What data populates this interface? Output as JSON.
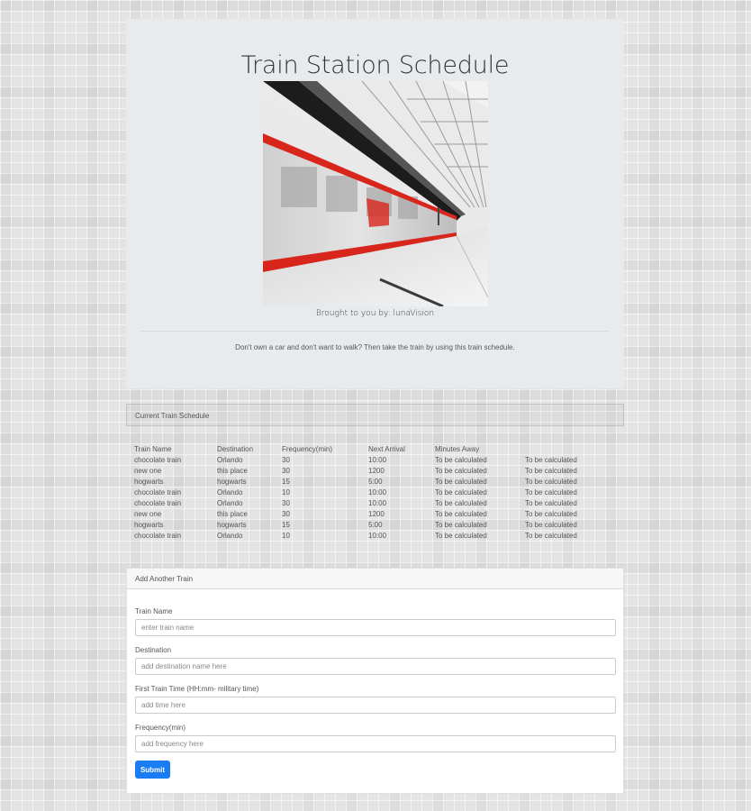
{
  "jumbotron": {
    "title": "Train Station Schedule",
    "byline": "Brought to you by: lunaVision",
    "tagline": "Don't own a car and don't want to walk? Then take the train by using this train schedule."
  },
  "schedule": {
    "header": "Current Train Schedule",
    "columns": [
      "Train Name",
      "Destination",
      "Frequency(min)",
      "Next Arrival",
      "Minutes Away",
      ""
    ],
    "rows": [
      [
        "chocolate train",
        "Orlando",
        "30",
        "10:00",
        "To be calculated",
        "To be calculated"
      ],
      [
        "new one",
        "this place",
        "30",
        "1200",
        "To be calculated",
        "To be calculated"
      ],
      [
        "hogwarts",
        "hogwarts",
        "15",
        "5:00",
        "To be calculated",
        "To be calculated"
      ],
      [
        "chocolate train",
        "Orlando",
        "10",
        "10:00",
        "To be calculated",
        "To be calculated"
      ],
      [
        "chocolate train",
        "Orlando",
        "30",
        "10:00",
        "To be calculated",
        "To be calculated"
      ],
      [
        "new one",
        "this place",
        "30",
        "1200",
        "To be calculated",
        "To be calculated"
      ],
      [
        "hogwarts",
        "hogwarts",
        "15",
        "5:00",
        "To be calculated",
        "To be calculated"
      ],
      [
        "chocolate train",
        "Orlando",
        "10",
        "10:00",
        "To be calculated",
        "To be calculated"
      ]
    ]
  },
  "form": {
    "header": "Add Another Train",
    "name_label": "Train Name",
    "name_placeholder": "enter train name",
    "destination_label": "Destination",
    "destination_placeholder": "add destination name here",
    "time_label": "First Train Time (HH:mm- military time)",
    "time_placeholder": "add time here",
    "frequency_label": "Frequency(min)",
    "frequency_placeholder": "add frequency here",
    "submit_label": "Submit"
  },
  "colors": {
    "jumbotron_bg": "#e8ebee",
    "primary": "#1a7cf3",
    "accent_red": "#d9261c"
  }
}
